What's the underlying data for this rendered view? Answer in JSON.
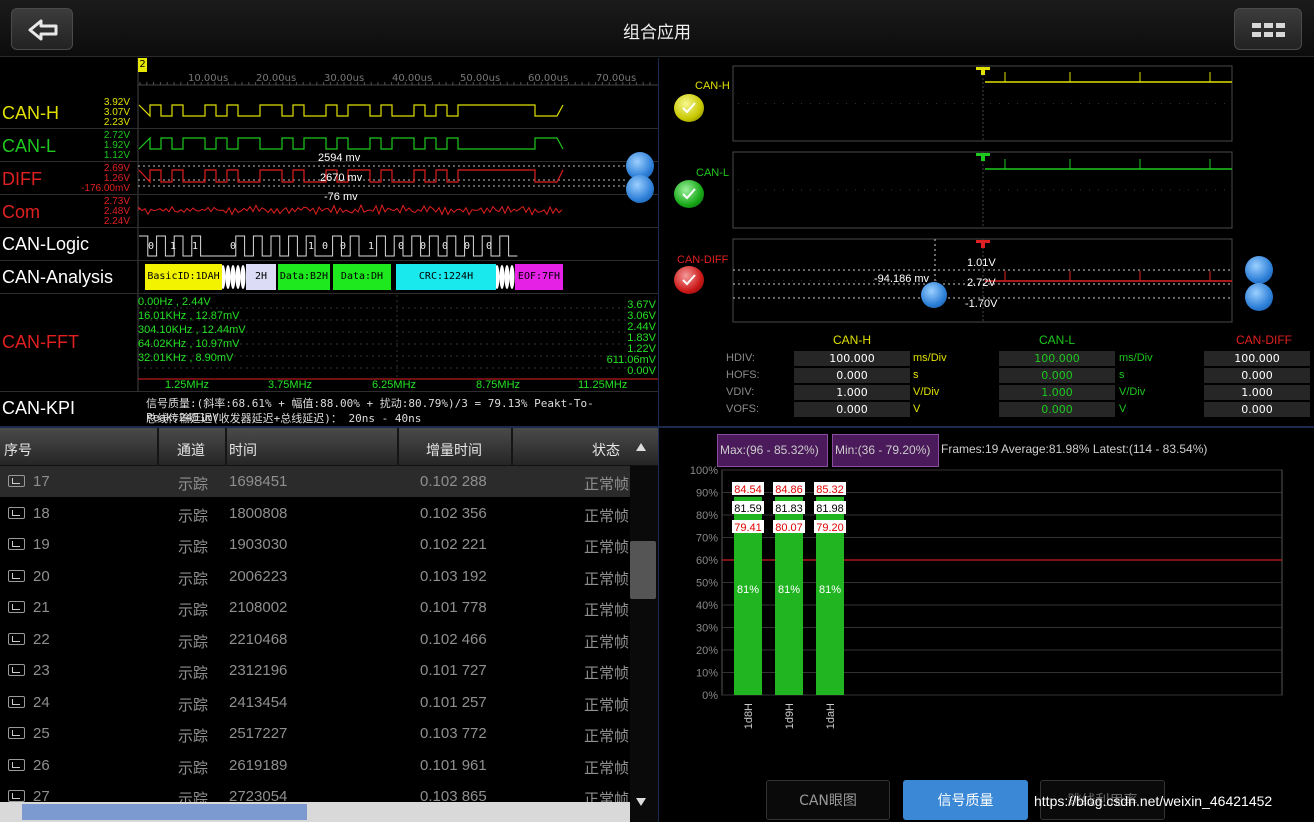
{
  "header": {
    "title": "组合应用",
    "back_icon": "arrow-left-icon",
    "menu_icon": "grid-icon"
  },
  "scope": {
    "cursor_marker": "2",
    "time_ticks": [
      "10.00us",
      "20.00us",
      "30.00us",
      "40.00us",
      "50.00us",
      "60.00us",
      "70.00us"
    ],
    "channels": [
      {
        "name": "CAN-H",
        "color": "#e0e000",
        "v": [
          "3.92V",
          "3.07V",
          "2.23V"
        ]
      },
      {
        "name": "CAN-L",
        "color": "#1ec81e",
        "v": [
          "2.72V",
          "1.92V",
          "1.12V"
        ]
      },
      {
        "name": "DIFF",
        "color": "#e02020",
        "v": [
          "2.69V",
          "1.26V",
          "-176.00mV"
        ]
      },
      {
        "name": "Com",
        "color": "#e02020",
        "v": [
          "2.73V",
          "2.48V",
          "2.24V"
        ]
      },
      {
        "name": "CAN-Logic",
        "color": "#ffffff"
      },
      {
        "name": "CAN-Analysis",
        "color": "#ffffff"
      },
      {
        "name": "CAN-FFT",
        "color": "#e02020"
      },
      {
        "name": "CAN-KPI",
        "color": "#ffffff"
      }
    ],
    "annotations": [
      "2594 mv",
      "2670 mv",
      "-76 mv"
    ],
    "logic_bits": [
      "0",
      "1",
      "1",
      "0",
      "1",
      "0",
      "0",
      "1",
      "0",
      "0",
      "0",
      "0",
      "0"
    ],
    "analysis_segments": [
      {
        "label": "BasicID:1DAH",
        "color": "#f3f300"
      },
      {
        "label": "2H",
        "color": "#dcdcf6"
      },
      {
        "label": "Data:B2H",
        "color": "#1ee81e"
      },
      {
        "label": "Data:DH",
        "color": "#1ee81e"
      },
      {
        "label": "CRC:1224H",
        "color": "#19e8ec"
      },
      {
        "label": "EOF:7FH",
        "color": "#e621e6"
      }
    ],
    "fft_peaks": [
      "0.00Hz , 2.44V",
      "16.01KHz , 12.87mV",
      "304.10KHz , 12.44mV",
      "64.02KHz , 10.97mV",
      "32.01KHz , 8.90mV"
    ],
    "fft_levels": [
      "3.67V",
      "3.06V",
      "2.44V",
      "1.83V",
      "1.22V",
      "611.06mV",
      "0.00V"
    ],
    "fft_freqs": [
      "1.25MHz",
      "3.75MHz",
      "6.25MHz",
      "8.75MHz",
      "11.25MHz"
    ],
    "kpi_lines": [
      "信号质量:(斜率:68.61% + 幅值:88.00% + 扰动:80.79%)/3 = 79.13%  Peakt-To-Peak:2451mV",
      "总线传输延迟(收发器延迟+总线延迟)： 20ns - 40ns"
    ]
  },
  "zoom": {
    "channels": [
      {
        "name": "CAN-H",
        "color": "#e0e000"
      },
      {
        "name": "CAN-L",
        "color": "#1ec81e"
      },
      {
        "name": "CAN-DIFF",
        "color": "#e02020"
      }
    ],
    "diff_labels": [
      "-94.186 mv",
      "1.01V",
      "2.72V",
      "-1.70V"
    ],
    "param_headers": [
      "CAN-H",
      "CAN-L",
      "CAN-DIFF"
    ],
    "param_rows": [
      {
        "name": "HDIV:",
        "v": [
          "100.000",
          "100.000",
          "100.000"
        ],
        "unit": "ms/Div"
      },
      {
        "name": "HOFS:",
        "v": [
          "0.000",
          "0.000",
          "0.000"
        ],
        "unit": "s"
      },
      {
        "name": "VDIV:",
        "v": [
          "1.000",
          "1.000",
          "1.000"
        ],
        "unit": "V/Div"
      },
      {
        "name": "VOFS:",
        "v": [
          "0.000",
          "0.000",
          "0.000"
        ],
        "unit": "V"
      }
    ]
  },
  "table": {
    "columns": [
      "序号",
      "通道",
      "时间",
      "增量时间",
      "状态"
    ],
    "rows": [
      [
        "17",
        "示踪",
        "1698451",
        "0.102 288",
        "正常帧"
      ],
      [
        "18",
        "示踪",
        "1800808",
        "0.102 356",
        "正常帧"
      ],
      [
        "19",
        "示踪",
        "1903030",
        "0.102 221",
        "正常帧"
      ],
      [
        "20",
        "示踪",
        "2006223",
        "0.103 192",
        "正常帧"
      ],
      [
        "21",
        "示踪",
        "2108002",
        "0.101 778",
        "正常帧"
      ],
      [
        "22",
        "示踪",
        "2210468",
        "0.102 466",
        "正常帧"
      ],
      [
        "23",
        "示踪",
        "2312196",
        "0.101 727",
        "正常帧"
      ],
      [
        "24",
        "示踪",
        "2413454",
        "0.101 257",
        "正常帧"
      ],
      [
        "25",
        "示踪",
        "2517227",
        "0.103 772",
        "正常帧"
      ],
      [
        "26",
        "示踪",
        "2619189",
        "0.101 961",
        "正常帧"
      ],
      [
        "27",
        "示踪",
        "2723054",
        "0.103 865",
        "正常帧"
      ]
    ]
  },
  "quality": {
    "max_tag": "Max:(96 - 85.32%)",
    "min_tag": "Min:(36 - 79.20%)",
    "summary": "Frames:19 Average:81.98% Latest:(114 - 83.54%)",
    "buttons": [
      "CAN眼图",
      "信号质量",
      "跳线利用率"
    ],
    "active_button": 1
  },
  "watermark": "https://blog.csdn.net/weixin_46421452",
  "chart_data": {
    "type": "bar",
    "categories": [
      "1d8H",
      "1d9H",
      "1daH"
    ],
    "series": [
      {
        "name": "max",
        "values": [
          84.54,
          84.86,
          85.32
        ]
      },
      {
        "name": "avg",
        "values": [
          81.59,
          81.83,
          81.98
        ]
      },
      {
        "name": "min",
        "values": [
          79.41,
          80.07,
          79.2
        ]
      }
    ],
    "bar_labels": [
      "81%",
      "81%",
      "81%"
    ],
    "bar_values": [
      81,
      81,
      81
    ],
    "yticks": [
      "100%",
      "90%",
      "80%",
      "70%",
      "60%",
      "50%",
      "40%",
      "30%",
      "20%",
      "10%",
      "0%"
    ],
    "ylim": [
      0,
      100
    ],
    "threshold": 60,
    "colors": {
      "bar": "#22b522",
      "threshold": "#cc1c1c",
      "max": "#e00000",
      "avg": "#000000",
      "min": "#e00000"
    }
  }
}
